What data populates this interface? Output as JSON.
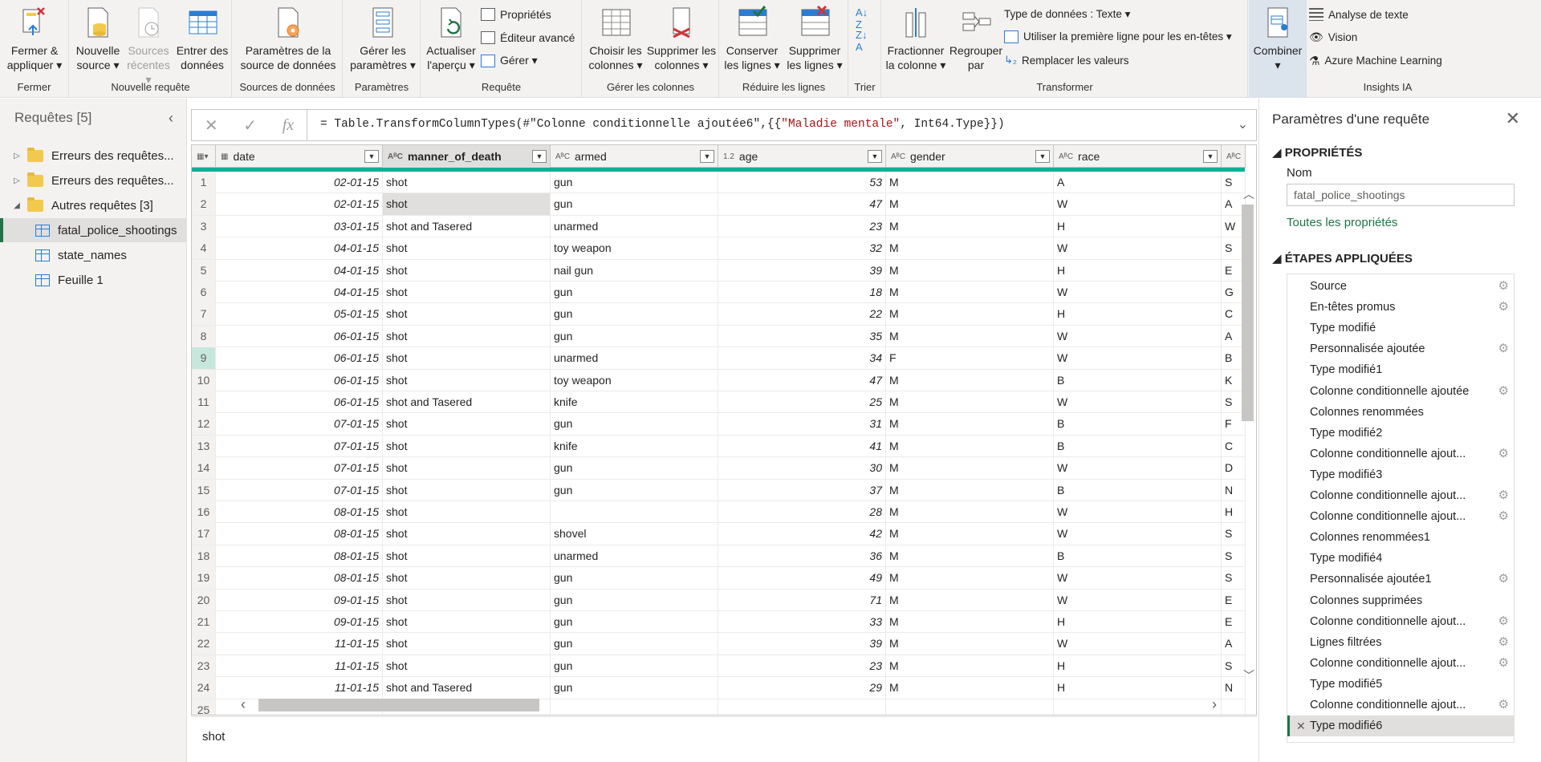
{
  "ribbon": {
    "groups": [
      {
        "label": "Fermer"
      },
      {
        "label": "Nouvelle requête"
      },
      {
        "label": "Sources de données"
      },
      {
        "label": "Paramètres"
      },
      {
        "label": "Requête"
      },
      {
        "label": "Gérer les colonnes"
      },
      {
        "label": "Réduire les lignes"
      },
      {
        "label": "Trier"
      },
      {
        "label": "Transformer"
      },
      {
        "label": "Insights IA"
      }
    ],
    "close_apply": [
      "Fermer &",
      "appliquer ▾"
    ],
    "new_source": [
      "Nouvelle",
      "source ▾"
    ],
    "recent_sources": [
      "Sources",
      "récentes ▾"
    ],
    "enter_data": [
      "Entrer des",
      "données"
    ],
    "source_settings": [
      "Paramètres de la",
      "source de données"
    ],
    "manage_params": [
      "Gérer les",
      "paramètres ▾"
    ],
    "refresh_preview": [
      "Actualiser",
      "l'aperçu ▾"
    ],
    "properties": "Propriétés",
    "advanced_editor": "Éditeur avancé",
    "manage": "Gérer ▾",
    "choose_columns": [
      "Choisir les",
      "colonnes ▾"
    ],
    "remove_columns": [
      "Supprimer les",
      "colonnes ▾"
    ],
    "keep_rows": [
      "Conserver",
      "les lignes ▾"
    ],
    "remove_rows": [
      "Supprimer",
      "les lignes ▾"
    ],
    "split_column": [
      "Fractionner",
      "la colonne ▾"
    ],
    "group_by": [
      "Regrouper",
      "par"
    ],
    "data_type": "Type de données : Texte ▾",
    "use_first_row": "Utiliser la première ligne pour les en-têtes ▾",
    "replace_values": "Remplacer les valeurs",
    "combine": [
      "Combiner",
      "▾"
    ],
    "text_analytics": "Analyse de texte",
    "vision": "Vision",
    "azure_ml": "Azure Machine Learning"
  },
  "queries": {
    "title": "Requêtes [5]",
    "items": [
      {
        "label": "Erreurs des requêtes...",
        "kind": "folder"
      },
      {
        "label": "Erreurs des requêtes...",
        "kind": "folder"
      },
      {
        "label": "Autres requêtes [3]",
        "kind": "folder-open"
      },
      {
        "label": "fatal_police_shootings",
        "kind": "table"
      },
      {
        "label": "state_names",
        "kind": "table"
      },
      {
        "label": "Feuille 1",
        "kind": "table"
      }
    ]
  },
  "formula": {
    "prefix": "= Table.TransformColumnTypes(#\"Colonne conditionnelle ajoutée6\",{{",
    "string": "\"Maladie mentale\"",
    "suffix": ", Int64.Type}})"
  },
  "grid": {
    "columns": [
      {
        "name": "date",
        "type": "▦"
      },
      {
        "name": "manner_of_death",
        "type": "AᴮC"
      },
      {
        "name": "armed",
        "type": "AᴮC"
      },
      {
        "name": "age",
        "type": "1.2"
      },
      {
        "name": "gender",
        "type": "AᴮC"
      },
      {
        "name": "race",
        "type": "AᴮC"
      },
      {
        "name": "",
        "type": "AᴮC"
      }
    ],
    "rows": [
      [
        "1",
        "02-01-15",
        "shot",
        "gun",
        "53",
        "M",
        "A",
        "S"
      ],
      [
        "2",
        "02-01-15",
        "shot",
        "gun",
        "47",
        "M",
        "W",
        "A"
      ],
      [
        "3",
        "03-01-15",
        "shot and Tasered",
        "unarmed",
        "23",
        "M",
        "H",
        "W"
      ],
      [
        "4",
        "04-01-15",
        "shot",
        "toy weapon",
        "32",
        "M",
        "W",
        "S"
      ],
      [
        "5",
        "04-01-15",
        "shot",
        "nail gun",
        "39",
        "M",
        "H",
        "E"
      ],
      [
        "6",
        "04-01-15",
        "shot",
        "gun",
        "18",
        "M",
        "W",
        "G"
      ],
      [
        "7",
        "05-01-15",
        "shot",
        "gun",
        "22",
        "M",
        "H",
        "C"
      ],
      [
        "8",
        "06-01-15",
        "shot",
        "gun",
        "35",
        "M",
        "W",
        "A"
      ],
      [
        "9",
        "06-01-15",
        "shot",
        "unarmed",
        "34",
        "F",
        "W",
        "B"
      ],
      [
        "10",
        "06-01-15",
        "shot",
        "toy weapon",
        "47",
        "M",
        "B",
        "K"
      ],
      [
        "11",
        "06-01-15",
        "shot and Tasered",
        "knife",
        "25",
        "M",
        "W",
        "S"
      ],
      [
        "12",
        "07-01-15",
        "shot",
        "gun",
        "31",
        "M",
        "B",
        "F"
      ],
      [
        "13",
        "07-01-15",
        "shot",
        "knife",
        "41",
        "M",
        "B",
        "C"
      ],
      [
        "14",
        "07-01-15",
        "shot",
        "gun",
        "30",
        "M",
        "W",
        "D"
      ],
      [
        "15",
        "07-01-15",
        "shot",
        "gun",
        "37",
        "M",
        "B",
        "N"
      ],
      [
        "16",
        "08-01-15",
        "shot",
        "",
        "28",
        "M",
        "W",
        "H"
      ],
      [
        "17",
        "08-01-15",
        "shot",
        "shovel",
        "42",
        "M",
        "W",
        "S"
      ],
      [
        "18",
        "08-01-15",
        "shot",
        "unarmed",
        "36",
        "M",
        "B",
        "S"
      ],
      [
        "19",
        "08-01-15",
        "shot",
        "gun",
        "49",
        "M",
        "W",
        "S"
      ],
      [
        "20",
        "09-01-15",
        "shot",
        "gun",
        "71",
        "M",
        "W",
        "E"
      ],
      [
        "21",
        "09-01-15",
        "shot",
        "gun",
        "33",
        "M",
        "H",
        "E"
      ],
      [
        "22",
        "11-01-15",
        "shot",
        "gun",
        "39",
        "M",
        "W",
        "A"
      ],
      [
        "23",
        "11-01-15",
        "shot",
        "gun",
        "23",
        "M",
        "H",
        "S"
      ],
      [
        "24",
        "11-01-15",
        "shot and Tasered",
        "gun",
        "29",
        "M",
        "H",
        "N"
      ],
      [
        "25",
        "",
        "",
        "",
        "",
        "",
        "",
        ""
      ]
    ],
    "selected_cell_value": "shot"
  },
  "settings": {
    "title": "Paramètres d'une requête",
    "properties_header": "PROPRIÉTÉS",
    "name_label": "Nom",
    "name_value": "fatal_police_shootings",
    "all_properties": "Toutes les propriétés",
    "steps_header": "ÉTAPES APPLIQUÉES",
    "steps": [
      {
        "label": "Source",
        "gear": true
      },
      {
        "label": "En-têtes promus",
        "gear": true
      },
      {
        "label": "Type modifié",
        "gear": false
      },
      {
        "label": "Personnalisée ajoutée",
        "gear": true
      },
      {
        "label": "Type modifié1",
        "gear": false
      },
      {
        "label": "Colonne conditionnelle ajoutée",
        "gear": true
      },
      {
        "label": "Colonnes renommées",
        "gear": false
      },
      {
        "label": "Type modifié2",
        "gear": false
      },
      {
        "label": "Colonne conditionnelle ajout...",
        "gear": true
      },
      {
        "label": "Type modifié3",
        "gear": false
      },
      {
        "label": "Colonne conditionnelle ajout...",
        "gear": true
      },
      {
        "label": "Colonne conditionnelle ajout...",
        "gear": true
      },
      {
        "label": "Colonnes renommées1",
        "gear": false
      },
      {
        "label": "Type modifié4",
        "gear": false
      },
      {
        "label": "Personnalisée ajoutée1",
        "gear": true
      },
      {
        "label": "Colonnes supprimées",
        "gear": false
      },
      {
        "label": "Colonne conditionnelle ajout...",
        "gear": true
      },
      {
        "label": "Lignes filtrées",
        "gear": true
      },
      {
        "label": "Colonne conditionnelle ajout...",
        "gear": true
      },
      {
        "label": "Type modifié5",
        "gear": false
      },
      {
        "label": "Colonne conditionnelle ajout...",
        "gear": true
      },
      {
        "label": "Type modifié6",
        "gear": false,
        "selected": true
      }
    ]
  },
  "colors": {
    "accent": "#217346",
    "quality": "#00b294",
    "selection": "#e1dfdd"
  }
}
